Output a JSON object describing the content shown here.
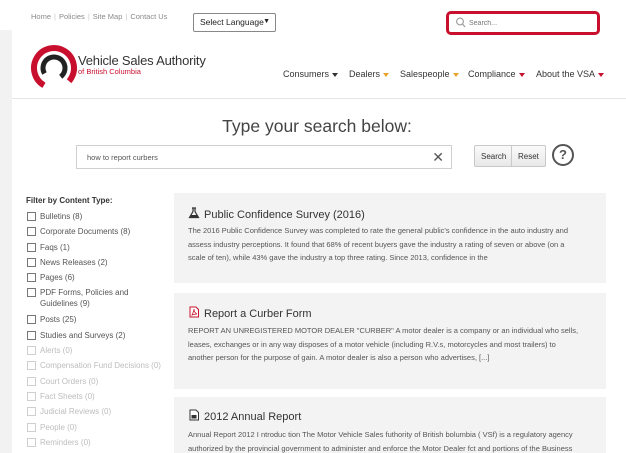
{
  "header": {
    "links": [
      "Home",
      "Policies",
      "Site Map",
      "Contact Us"
    ],
    "language_select": "Select Language",
    "search_placeholder": "Search..."
  },
  "brand": {
    "title": "Vehicle Sales Authority",
    "subtitle": "of British Columbia",
    "colors": {
      "red": "#c8102e",
      "dark": "#333333",
      "orange": "#e8a32a"
    }
  },
  "nav": [
    {
      "label": "Consumers",
      "caret_color": "dark"
    },
    {
      "label": "Dealers",
      "caret_color": "orange"
    },
    {
      "label": "Salespeople",
      "caret_color": "orange"
    },
    {
      "label": "Compliance",
      "caret_color": "red"
    },
    {
      "label": "About the VSA",
      "caret_color": "red"
    }
  ],
  "search": {
    "heading": "Type your search below:",
    "query": "how to report curbers",
    "search_label": "Search",
    "reset_label": "Reset",
    "clear_glyph": "✕",
    "help_glyph": "?"
  },
  "filters": {
    "title": "Filter by Content Type:",
    "items": [
      {
        "label": "Bulletins (8)",
        "enabled": true
      },
      {
        "label": "Corporate Documents (8)",
        "enabled": true
      },
      {
        "label": "Faqs (1)",
        "enabled": true
      },
      {
        "label": "News Releases (2)",
        "enabled": true
      },
      {
        "label": "Pages (6)",
        "enabled": true
      },
      {
        "label": "PDF Forms, Policies and Guidelines (9)",
        "enabled": true
      },
      {
        "label": "Posts (25)",
        "enabled": true
      },
      {
        "label": "Studies and Surveys (2)",
        "enabled": true
      },
      {
        "label": "Alerts (0)",
        "enabled": false
      },
      {
        "label": "Compensation Fund Decisions (0)",
        "enabled": false
      },
      {
        "label": "Court Orders (0)",
        "enabled": false
      },
      {
        "label": "Fact Sheets (0)",
        "enabled": false
      },
      {
        "label": "Judicial Reviews (0)",
        "enabled": false
      },
      {
        "label": "People (0)",
        "enabled": false
      },
      {
        "label": "Reminders (0)",
        "enabled": false
      }
    ]
  },
  "results": [
    {
      "icon": "flask-icon",
      "title": "Public Confidence Survey (2016)",
      "lines": [
        "The 2016 Public Confidence Survey was completed to rate the general public's confidence in the auto industry and",
        "assess industry perceptions. It found that 68% of recent buyers gave the industry a rating of seven or above (on a",
        "scale of ten), while 43% gave the industry a top three rating. Since 2013, confidence in the"
      ]
    },
    {
      "icon": "pdf-icon",
      "title": "Report a Curber Form",
      "lines": [
        "REPORT AN UNREGISTERED MOTOR DEALER \"CURBER\" A motor dealer is a company or an individual who sells,",
        "leases, exchanges or in any way disposes of a motor vehicle (including R.V.s, motorcycles and most trailers) to",
        "another person for the purpose of gain. A motor dealer is also a person who advertises, [...]"
      ]
    },
    {
      "icon": "document-icon",
      "title": "2012 Annual Report",
      "lines": [
        "Annual Report 2012 I ntroduc tion The Motor Vehicle Sales futhority of British bolumbia ( VSf) is a regulatory agency",
        "authorized by the provincial government to administer and enforce the Motor Dealer fct and portions of the Business"
      ]
    }
  ]
}
